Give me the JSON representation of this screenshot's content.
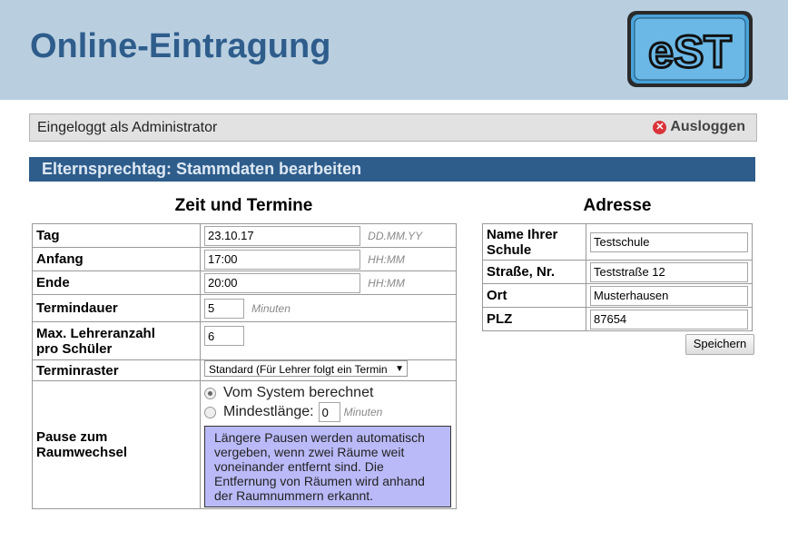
{
  "header": {
    "title": "Online-Eintragung",
    "logo_text": "eST"
  },
  "login": {
    "status_text": "Eingeloggt als Administrator",
    "logout_label": "Ausloggen"
  },
  "section": {
    "title": "Elternsprechtag: Stammdaten bearbeiten"
  },
  "zeit": {
    "title": "Zeit und Termine",
    "tag": {
      "label": "Tag",
      "value": "23.10.17",
      "hint": "DD.MM.YY"
    },
    "anfang": {
      "label": "Anfang",
      "value": "17:00",
      "hint": "HH:MM"
    },
    "ende": {
      "label": "Ende",
      "value": "20:00",
      "hint": "HH:MM"
    },
    "termindauer": {
      "label": "Termindauer",
      "value": "5",
      "hint": "Minuten"
    },
    "max_lehrer": {
      "label_line1": "Max. Lehreranzahl",
      "label_line2": "pro Schüler",
      "value": "6"
    },
    "terminraster": {
      "label": "Terminraster",
      "selected": "Standard (Für Lehrer folgt ein Termin"
    },
    "pause": {
      "label_line1": "Pause zum",
      "label_line2": "Raumwechsel",
      "option1": "Vom System berechnet",
      "option2": "Mindestlänge:",
      "mindest_value": "0",
      "hint": "Minuten",
      "info_line1": "Längere Pausen werden automatisch",
      "info_line2": "vergeben, wenn zwei Räume weit",
      "info_line3": "voneinander entfernt sind. Die",
      "info_line4": "Entfernung von Räumen wird anhand",
      "info_line5": "der Raumnummern erkannt."
    }
  },
  "adresse": {
    "title": "Adresse",
    "name": {
      "label_line1": "Name Ihrer",
      "label_line2": "Schule",
      "value": "Testschule"
    },
    "strasse": {
      "label": "Straße, Nr.",
      "value": "Teststraße 12"
    },
    "ort": {
      "label": "Ort",
      "value": "Musterhausen"
    },
    "plz": {
      "label": "PLZ",
      "value": "87654"
    },
    "save_label": "Speichern"
  }
}
